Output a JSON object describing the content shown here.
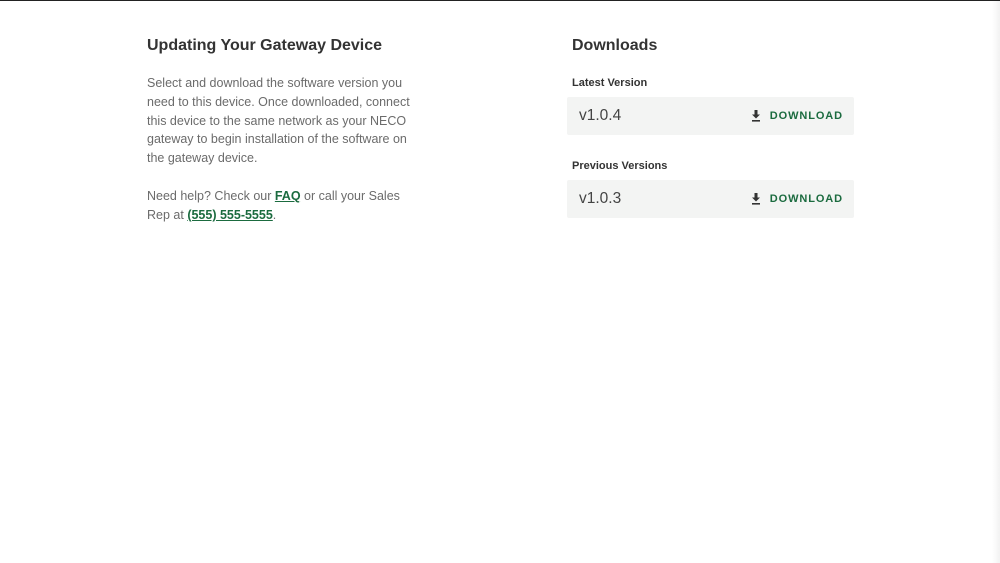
{
  "info": {
    "title": "Updating Your Gateway Device",
    "description": "Select and download the software version you need to this device. Once downloaded, connect this device to the same network as your NECO gateway to begin installation of the software on the gateway device.",
    "help_prefix": "Need help? Check our ",
    "faq_link": "FAQ",
    "help_middle": " or call your Sales Rep at ",
    "phone_link": "(555) 555-5555",
    "help_suffix": "."
  },
  "downloads": {
    "title": "Downloads",
    "latest": {
      "label": "Latest Version",
      "version": "v1.0.4",
      "button_label": "DOWNLOAD"
    },
    "previous": {
      "label": "Previous Versions",
      "items": [
        {
          "version": "v1.0.3",
          "button_label": "DOWNLOAD"
        }
      ]
    }
  },
  "icons": {
    "download": "download-icon"
  },
  "colors": {
    "accent": "#1b6b3f",
    "body_text": "#6b6b6b",
    "heading": "#333333",
    "panel_bg": "#f3f4f3"
  }
}
